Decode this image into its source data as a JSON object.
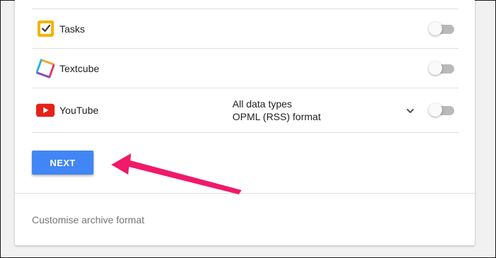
{
  "products": [
    {
      "name": "Tasks",
      "icon": "tasks-icon",
      "options": [],
      "has_dropdown": false,
      "enabled": false
    },
    {
      "name": "Textcube",
      "icon": "textcube-icon",
      "options": [],
      "has_dropdown": false,
      "enabled": false
    },
    {
      "name": "YouTube",
      "icon": "youtube-icon",
      "options": [
        "All data types",
        "OPML (RSS) format"
      ],
      "has_dropdown": true,
      "enabled": false
    }
  ],
  "next_label": "NEXT",
  "footer_link": "Customise archive format",
  "colors": {
    "primary_button": "#4285f4",
    "annotation_arrow": "#f0196a",
    "toggle_off_track": "#b9b9b9",
    "youtube_red": "#e62117",
    "tasks_yellow": "#f4b400"
  }
}
